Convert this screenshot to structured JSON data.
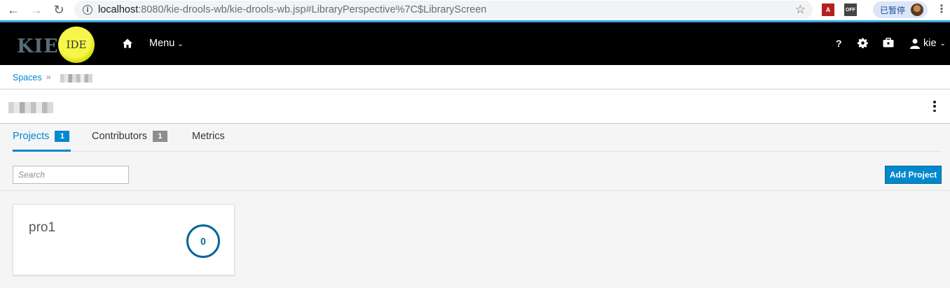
{
  "browser": {
    "url_host": "localhost",
    "url_rest": ":8080/kie-drools-wb/kie-drools-wb.jsp#LibraryPerspective%7C$LibraryScreen",
    "profile_label": "已暂停",
    "ext_off_label": "OFF",
    "icons": [
      "back-icon",
      "forward-icon",
      "reload-icon",
      "info-icon",
      "star-icon",
      "pdf-extension-icon",
      "off-extension-icon",
      "profile-avatar",
      "browser-menu-icon"
    ]
  },
  "header": {
    "brand_text": "KIE",
    "brand_badge": "IDE",
    "menu_label": "Menu",
    "help_label": "?",
    "user_label": "kie"
  },
  "breadcrumb": {
    "root_label": "Spaces"
  },
  "tabs": [
    {
      "label": "Projects",
      "count": "1",
      "active": true
    },
    {
      "label": "Contributors",
      "count": "1",
      "active": false
    },
    {
      "label": "Metrics",
      "active": false
    }
  ],
  "toolbar": {
    "search_placeholder": "Search",
    "add_project_label": "Add Project"
  },
  "projects": [
    {
      "name": "pro1",
      "asset_count": "0"
    }
  ],
  "colors": {
    "accent": "#0088ce",
    "header_bg": "#000000",
    "badge_muted": "#8b8d8f",
    "brand_ball": "#e8ee1e"
  }
}
